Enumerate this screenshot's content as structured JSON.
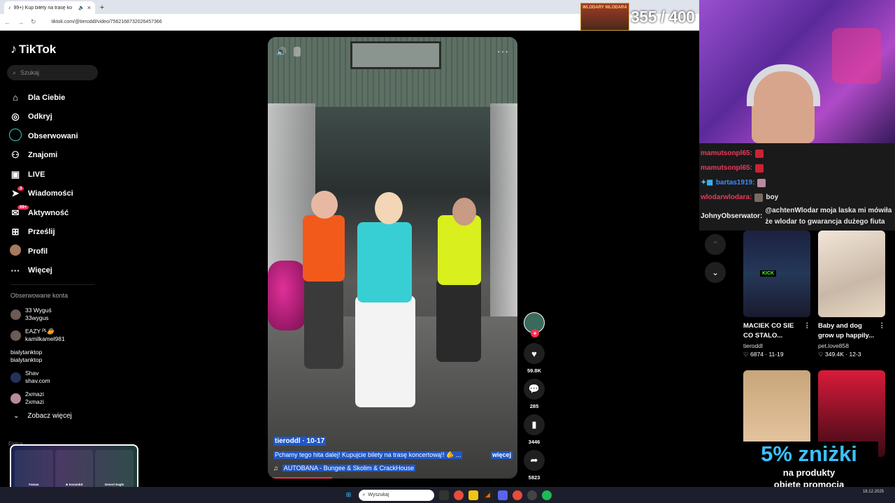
{
  "browser": {
    "tab_title": "99+) Kup bilety na trasę ko",
    "url": "tiktok.com/@tieroddl/video/7562168732026457366"
  },
  "sidebar": {
    "logo": "TikTok",
    "search_placeholder": "Szukaj",
    "nav": [
      {
        "label": "Dla Ciebie",
        "icon": "home-icon"
      },
      {
        "label": "Odkryj",
        "icon": "compass-icon"
      },
      {
        "label": "Obserwowani",
        "icon": "following-icon"
      },
      {
        "label": "Znajomi",
        "icon": "friends-icon"
      },
      {
        "label": "LIVE",
        "icon": "live-icon"
      },
      {
        "label": "Wiadomości",
        "icon": "messages-icon",
        "badge": "3"
      },
      {
        "label": "Aktywność",
        "icon": "activity-icon",
        "badge": "99+"
      },
      {
        "label": "Prześlij",
        "icon": "upload-icon"
      },
      {
        "label": "Profil",
        "icon": "profile-icon"
      },
      {
        "label": "Więcej",
        "icon": "more-icon"
      }
    ],
    "following_title": "Obserwowane konta",
    "accounts": [
      {
        "name": "33 Wyguś",
        "handle": "33wygus"
      },
      {
        "name": "EAZY ᴾᴸ🥭",
        "handle": "kamilkamel981"
      },
      {
        "name": "bialytanktop",
        "handle": "bialytanktop"
      },
      {
        "name": "Shav",
        "handle": "shav.com"
      },
      {
        "name": "2xmazi",
        "handle": "2xmazi"
      }
    ],
    "see_more": "Zobacz więcej",
    "firma": "Firma"
  },
  "cs_overlay": {
    "cards": [
      {
        "name": "Famas",
        "skin": "Sergeant"
      },
      {
        "name": "★ Karambit",
        "skin": "Case Hardened"
      },
      {
        "name": "Desert Eagle",
        "skin": "Emerald Dragon"
      }
    ]
  },
  "video": {
    "author": "tieroddl · 10-17",
    "description": "Pchamy tego hita dalej! Kupujcie bilety na trasę koncertową!! 🫵 ...",
    "more_label": "więcej",
    "music": "AUTOBANA - Bungee & Skolim & CrackHouse",
    "progress_fraction": 0.25
  },
  "actions": {
    "likes": "59.8K",
    "comments": "285",
    "saves": "3446",
    "shares": "5823"
  },
  "stream": {
    "counter_label": "WLODARY WLODARA",
    "counter": "355 / 400",
    "chat": [
      {
        "user": "mamutsonpl65:",
        "msg": "",
        "color": "red"
      },
      {
        "user": "mamutsonpl65:",
        "msg": "",
        "color": "red"
      },
      {
        "user": "bartas1919:",
        "msg": "",
        "color": "blue"
      },
      {
        "user": "wlodarwlodara:",
        "msg": "boy",
        "color": "red"
      },
      {
        "user": "JohnyObserwator:",
        "msg": "@achtenWlodar moja laska mi mówiła że wlodar to gwarancja dużego fiuta",
        "color": "white"
      }
    ]
  },
  "recommended": [
    {
      "title": "MACIEK CO SIE CO STALO...",
      "author": "tieroddl",
      "stats": "6874 · 11-19",
      "tag": "KICK"
    },
    {
      "title": "Baby and dog grow up happily...",
      "author": "pet.love858",
      "stats": "349.4K · 12-3"
    },
    {
      "title": "",
      "author": "",
      "stats": ""
    },
    {
      "title": "",
      "author": "",
      "stats": ""
    }
  ],
  "promo": {
    "big": "5% zniżki",
    "line1": "na produkty",
    "line2": "objęte promocją"
  },
  "taskbar": {
    "search_placeholder": "Wyszukaj",
    "date": "18.12.2025"
  }
}
